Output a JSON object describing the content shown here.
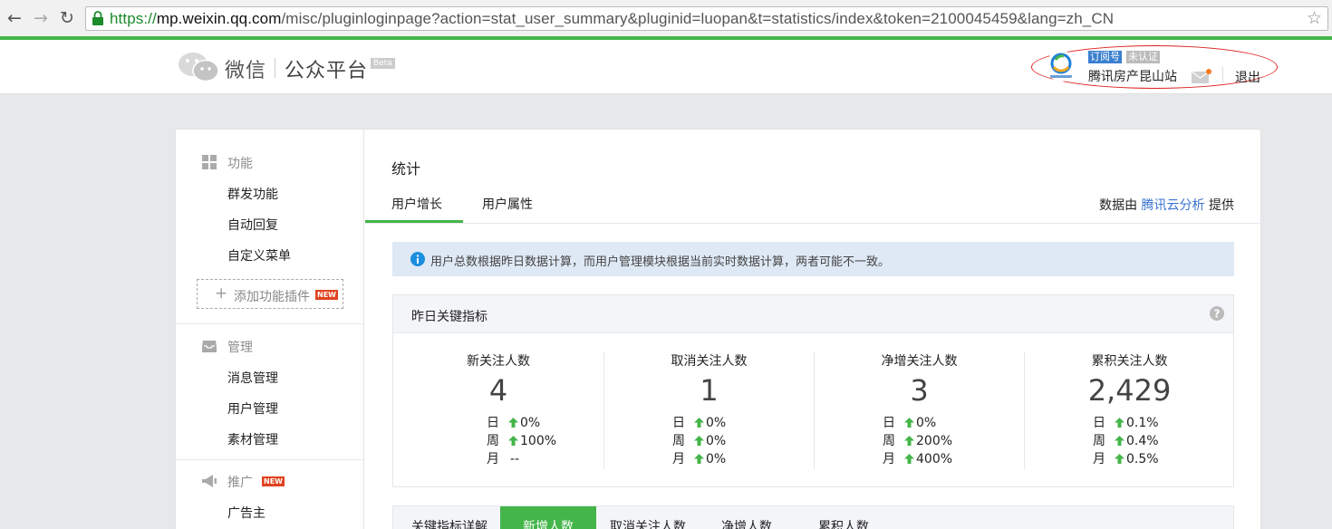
{
  "browser": {
    "url_scheme": "https://",
    "url_host": "mp.weixin.qq.com",
    "url_path": "/misc/pluginloginpage?action=stat_user_summary&pluginid=luopan&t=statistics/index&token=2100045459&lang=zh_CN",
    "accent_color": "#44b549"
  },
  "header": {
    "brand": "微信",
    "platform": "公众平台",
    "beta": "Beta",
    "account_type": "订阅号",
    "account_status": "未认证",
    "account_name": "腾讯房产昆山站",
    "logout": "退出"
  },
  "sidebar": {
    "groups": [
      {
        "title": "功能",
        "icon": "grid-icon",
        "items": [
          "群发功能",
          "自动回复",
          "自定义菜单"
        ]
      },
      {
        "title": "管理",
        "icon": "inbox-icon",
        "items": [
          "消息管理",
          "用户管理",
          "素材管理"
        ]
      },
      {
        "title": "推广",
        "icon": "megaphone-icon",
        "badge": "NEW",
        "items": [
          "广告主"
        ]
      }
    ],
    "add_plugin": "添加功能插件",
    "add_plugin_badge": "NEW"
  },
  "main": {
    "title": "统计",
    "tabs": [
      "用户增长",
      "用户属性"
    ],
    "provider_prefix": "数据由",
    "provider_link": "腾讯云分析",
    "provider_suffix": "提供",
    "notice": "用户总数根据昨日数据计算，而用户管理模块根据当前实时数据计算，两者可能不一致。",
    "kpi_title": "昨日关键指标",
    "kpis": [
      {
        "label": "新关注人数",
        "value": "4",
        "rows": [
          {
            "k": "日",
            "v": "0%",
            "up": true
          },
          {
            "k": "周",
            "v": "100%",
            "up": true
          },
          {
            "k": "月",
            "v": "--",
            "up": false
          }
        ]
      },
      {
        "label": "取消关注人数",
        "value": "1",
        "rows": [
          {
            "k": "日",
            "v": "0%",
            "up": true
          },
          {
            "k": "周",
            "v": "0%",
            "up": true
          },
          {
            "k": "月",
            "v": "0%",
            "up": true
          }
        ]
      },
      {
        "label": "净增关注人数",
        "value": "3",
        "rows": [
          {
            "k": "日",
            "v": "0%",
            "up": true
          },
          {
            "k": "周",
            "v": "200%",
            "up": true
          },
          {
            "k": "月",
            "v": "400%",
            "up": true
          }
        ]
      },
      {
        "label": "累积关注人数",
        "value": "2,429",
        "rows": [
          {
            "k": "日",
            "v": "0.1%",
            "up": true
          },
          {
            "k": "周",
            "v": "0.4%",
            "up": true
          },
          {
            "k": "月",
            "v": "0.5%",
            "up": true
          }
        ]
      }
    ],
    "bottom_tabs": {
      "label": "关键指标详解",
      "active": "新增人数",
      "others": [
        "取消关注人数",
        "净增人数",
        "累积人数"
      ]
    }
  }
}
